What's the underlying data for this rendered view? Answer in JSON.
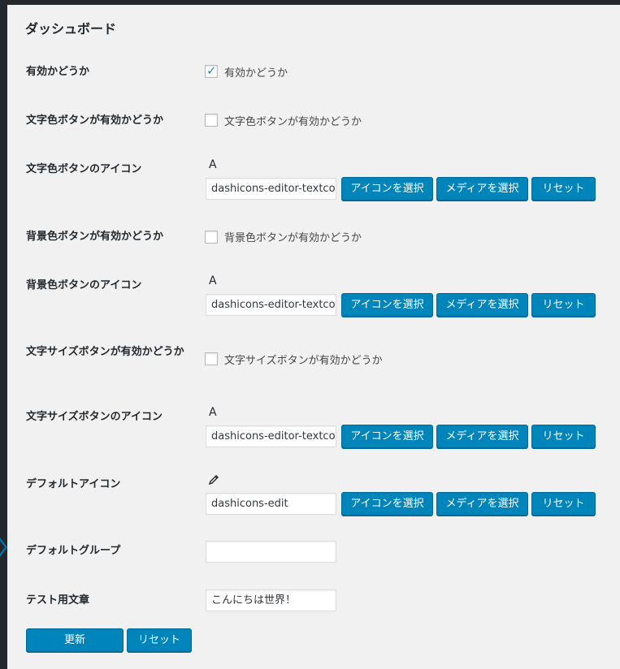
{
  "page": {
    "title": "ダッシュボード"
  },
  "buttons": {
    "select_icon": "アイコンを選択",
    "select_media": "メディアを選択",
    "reset": "リセット"
  },
  "rows": {
    "enabled": {
      "label": "有効かどうか",
      "checkbox_label": "有効かどうか",
      "checked": true
    },
    "color_enabled": {
      "label": "文字色ボタンが有効かどうか",
      "checkbox_label": "文字色ボタンが有効かどうか",
      "checked": false
    },
    "color_icon": {
      "label": "文字色ボタンのアイコン",
      "preview": "A",
      "value": "dashicons-editor-textcol"
    },
    "bg_enabled": {
      "label": "背景色ボタンが有効かどうか",
      "checkbox_label": "背景色ボタンが有効かどうか",
      "checked": false
    },
    "bg_icon": {
      "label": "背景色ボタンのアイコン",
      "preview": "A",
      "value": "dashicons-editor-textcol"
    },
    "size_enabled": {
      "label": "文字サイズボタンが有効かどうか",
      "checkbox_label": "文字サイズボタンが有効かどうか",
      "checked": false
    },
    "size_icon": {
      "label": "文字サイズボタンのアイコン",
      "preview": "A",
      "value": "dashicons-editor-textcol"
    },
    "default_icon": {
      "label": "デフォルトアイコン",
      "preview": "pencil-icon",
      "value": "dashicons-edit"
    },
    "default_group": {
      "label": "デフォルトグループ",
      "value": ""
    },
    "test_text": {
      "label": "テスト用文章",
      "value": "こんにちは世界！"
    }
  },
  "footer": {
    "update_label": "更新",
    "reset_label": "リセット"
  }
}
